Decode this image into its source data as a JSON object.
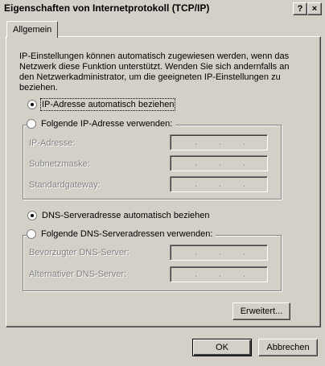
{
  "window": {
    "title": "Eigenschaften von Internetprotokoll (TCP/IP)",
    "help_btn": "?",
    "close_btn": "×"
  },
  "tabs": [
    {
      "label": "Allgemein"
    }
  ],
  "description": "IP-Einstellungen können automatisch zugewiesen werden, wenn das Netzwerk diese Funktion unterstützt. Wenden Sie sich andernfalls an den Netzwerkadministrator, um die geeigneten IP-Einstellungen zu beziehen.",
  "ip": {
    "auto_label": "IP-Adresse automatisch beziehen",
    "manual_label": "Folgende IP-Adresse verwenden:",
    "selected": "auto",
    "fields": [
      {
        "label": "IP-Adresse:"
      },
      {
        "label": "Subnetzmaske:"
      },
      {
        "label": "Standardgateway:"
      }
    ]
  },
  "dns": {
    "auto_label": "DNS-Serveradresse automatisch beziehen",
    "manual_label": "Folgende DNS-Serveradressen verwenden:",
    "selected": "auto",
    "fields": [
      {
        "label": "Bevorzugter DNS-Server:"
      },
      {
        "label": "Alternativer DNS-Server:"
      }
    ]
  },
  "buttons": {
    "advanced": "Erweitert...",
    "ok": "OK",
    "cancel": "Abbrechen"
  },
  "ip_dot": "."
}
